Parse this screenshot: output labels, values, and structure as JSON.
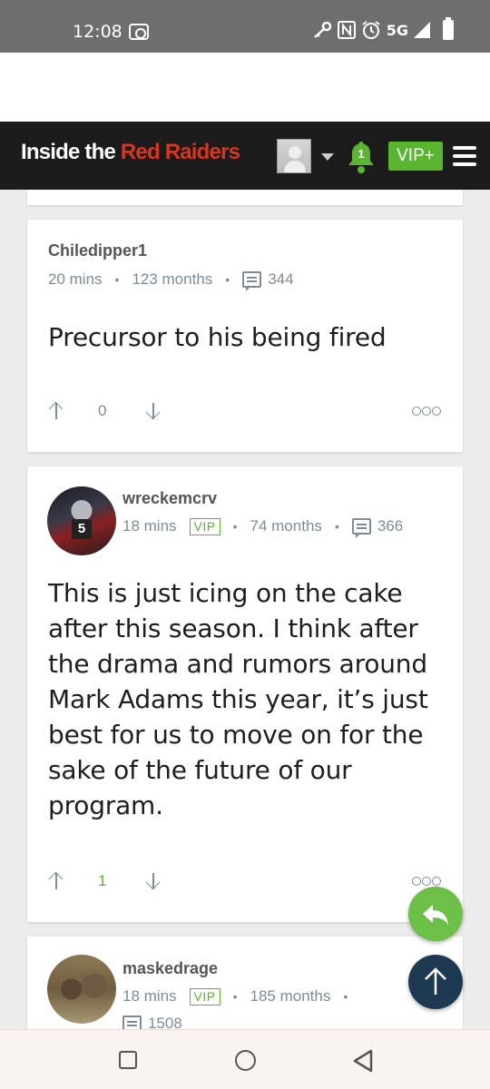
{
  "status_bar": {
    "time": "12:08",
    "network": "5G"
  },
  "header": {
    "logo_part1": "Inside the ",
    "logo_part2": "Red Raiders",
    "notification_count": "1",
    "vip_label": "VIP+",
    "colors": {
      "brand_red": "#d8351c",
      "accent_green": "#5ab531",
      "header_bg": "#1b1b1b"
    }
  },
  "posts": [
    {
      "username": "Chiledipper1",
      "time": "20 mins",
      "vip": false,
      "tenure": "123 months",
      "post_count": "344",
      "body": "Precursor to his being fired",
      "votes": "0",
      "vote_positive": false
    },
    {
      "username": "wreckemcrv",
      "time": "18 mins",
      "vip": true,
      "vip_label": "VIP",
      "tenure": "74 months",
      "post_count": "366",
      "body": "This is just icing on the cake after this season. I think after the drama and rumors around Mark Adams this year, it’s just best for us to move on for the sake of the future of our program.",
      "votes": "1",
      "vote_positive": true,
      "avatar_jersey": "5"
    },
    {
      "username": "maskedrage",
      "time": "18 mins",
      "vip": true,
      "vip_label": "VIP",
      "tenure": "185 months",
      "post_count": "1508"
    }
  ],
  "icons": {
    "reply": "reply-icon",
    "scroll_top": "arrow-up-icon",
    "more": "more-options-icon"
  }
}
